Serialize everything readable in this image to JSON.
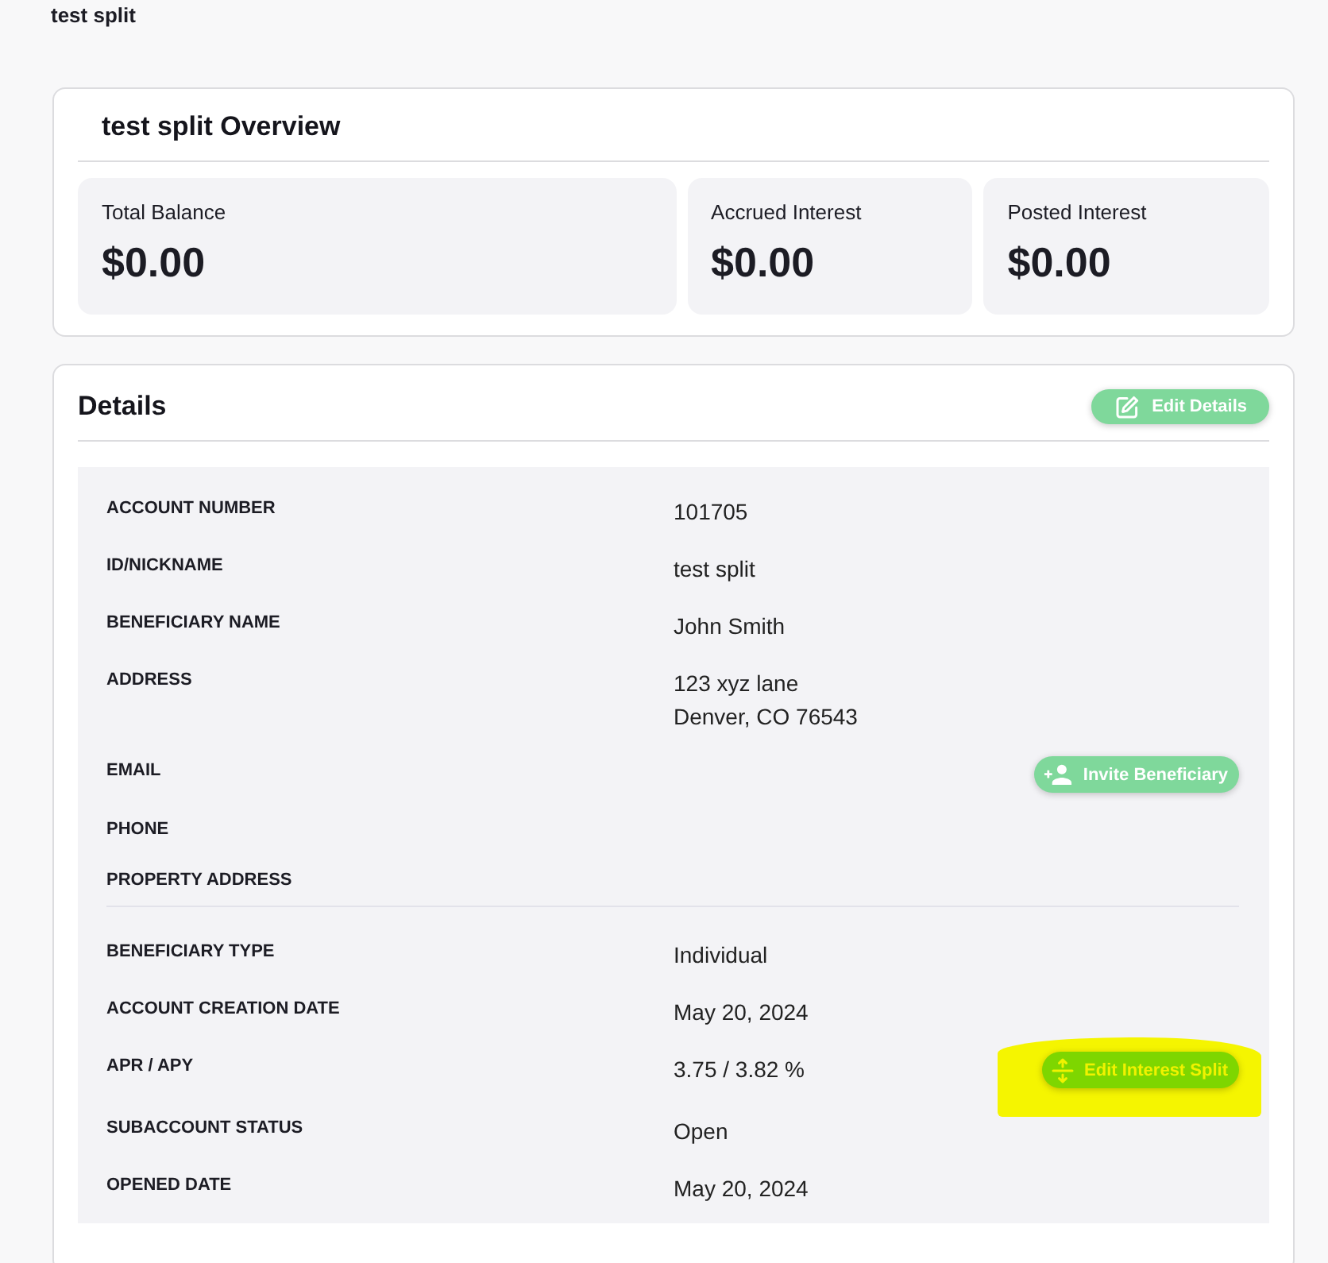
{
  "page": {
    "title": "test split"
  },
  "overview": {
    "title": "test split Overview",
    "stats": [
      {
        "label": "Total Balance",
        "value": "$0.00"
      },
      {
        "label": "Accrued Interest",
        "value": "$0.00"
      },
      {
        "label": "Posted Interest",
        "value": "$0.00"
      }
    ]
  },
  "details": {
    "title": "Details",
    "edit_button": {
      "label": "Edit Details"
    },
    "sections": [
      {
        "rows": [
          {
            "label": "ACCOUNT NUMBER",
            "value": "101705"
          },
          {
            "label": "ID/NICKNAME",
            "value": "test split"
          },
          {
            "label": "BENEFICIARY NAME",
            "value": "John Smith"
          },
          {
            "label": "ADDRESS",
            "value": "123 xyz lane\nDenver, CO 76543"
          },
          {
            "label": "EMAIL",
            "action": {
              "kind": "invite",
              "label": "Invite Beneficiary",
              "highlighted": false
            }
          },
          {
            "label": "PHONE"
          },
          {
            "label": "PROPERTY ADDRESS"
          }
        ]
      },
      {
        "rows": [
          {
            "label": "BENEFICIARY TYPE",
            "value": "Individual"
          },
          {
            "label": "ACCOUNT CREATION DATE",
            "value": "May 20, 2024"
          },
          {
            "label": "APR / APY",
            "value": "3.75 / 3.82 %",
            "action": {
              "kind": "split",
              "label": "Edit Interest Split",
              "highlighted": true
            }
          },
          {
            "label": "SUBACCOUNT STATUS",
            "value": "Open"
          },
          {
            "label": "OPENED DATE",
            "value": "May 20, 2024"
          }
        ]
      }
    ]
  }
}
